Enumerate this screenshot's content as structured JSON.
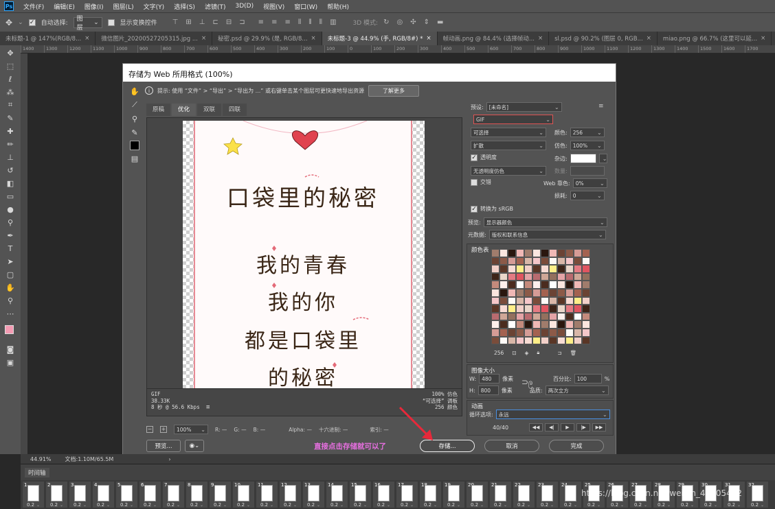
{
  "menubar": {
    "items": [
      "文件(F)",
      "编辑(E)",
      "图像(I)",
      "图层(L)",
      "文字(Y)",
      "选择(S)",
      "滤镜(T)",
      "3D(D)",
      "视图(V)",
      "窗口(W)",
      "帮助(H)"
    ]
  },
  "options": {
    "auto_select_label": "自动选择:",
    "layer_dropdown": "图层",
    "show_transform_label": "显示变换控件",
    "mode_3d_label": "3D 模式:"
  },
  "doc_tabs": [
    {
      "label": "未标题-1 @ 147%(RGB/8...",
      "active": false
    },
    {
      "label": "微信图片_20200527205315.jpg ...",
      "active": false
    },
    {
      "label": "秘密.psd @ 29.9% (是, RGB/8...",
      "active": false
    },
    {
      "label": "未标题-3 @ 44.9% (手, RGB/8#) *",
      "active": true
    },
    {
      "label": "帧动画.png @ 84.4% (选择帧动...",
      "active": false
    },
    {
      "label": "sl.psd @ 90.2% (图层 0, RGB...",
      "active": false
    },
    {
      "label": "miao.png @ 66.7% (这里可以延...",
      "active": false
    }
  ],
  "ruler": [
    "1400",
    "1300",
    "1200",
    "1100",
    "1000",
    "900",
    "800",
    "700",
    "600",
    "500",
    "400",
    "300",
    "200",
    "100",
    "0",
    "100",
    "200",
    "300",
    "400",
    "500",
    "600",
    "700",
    "800",
    "900",
    "1000",
    "1100",
    "1200",
    "1300",
    "1400",
    "1500",
    "1600",
    "1700"
  ],
  "status": {
    "zoom": "44.91%",
    "doc": "文档:1.10M/65.5M"
  },
  "timeline": {
    "title": "时间轴",
    "frame_delay": "0.2",
    "frames": [
      "1",
      "2",
      "3",
      "4",
      "5",
      "6",
      "7",
      "8",
      "9",
      "10",
      "11",
      "12",
      "13",
      "14",
      "15",
      "16",
      "17",
      "18",
      "19",
      "20",
      "21",
      "22",
      "23",
      "24",
      "25",
      "26",
      "27",
      "28",
      "29",
      "30",
      "31",
      "32"
    ],
    "watermark": "https://blog.csdn.net/weixin_45405452"
  },
  "dialog": {
    "title": "存储为 Web 所用格式 (100%)",
    "hint": "提示: 使用 “文件” > “导出” > “导出为 ...” 或右键单击某个图层可更快速地导出资源",
    "learn_more": "了解更多",
    "view_tabs": [
      "原稿",
      "优化",
      "双联",
      "四联"
    ],
    "active_tab": "优化",
    "poster": {
      "title": "口袋里的秘密",
      "lines": [
        "我的青春",
        "我的你",
        "都是口袋里",
        "的秘密"
      ]
    },
    "preview_info": {
      "format": "GIF",
      "size": "38.33K",
      "time": "8 秒 @ 56.6 Kbps",
      "dither": "100% 仿色",
      "palette": "“可选择” 调板",
      "colors": "256 颜色"
    },
    "zoom_row": {
      "zoom": "100%",
      "r": "R: —",
      "g": "G: —",
      "b": "B: —",
      "alpha": "Alpha: —",
      "hex": "十六进制: —",
      "index": "索引: —"
    },
    "buttons": {
      "preview": "预览...",
      "save": "存储...",
      "cancel": "取消",
      "done": "完成"
    },
    "annotation": "直接点击存储就可以了",
    "settings": {
      "preset_label": "预设:",
      "preset_value": "[未命名]",
      "format": "GIF",
      "reduction": "可选择",
      "dither_algo": "扩散",
      "colors_label": "颜色:",
      "colors_value": "256",
      "dither_label": "仿色:",
      "dither_value": "100%",
      "transparency_label": "透明度",
      "matte_label": "杂边:",
      "transparency_dither": "无透明度仿色",
      "amount_label": "数量:",
      "interlaced_label": "交错",
      "web_snap_label": "Web 靠色:",
      "web_snap_value": "0%",
      "lossy_label": "损耗:",
      "lossy_value": "0",
      "convert_srgb": "转换为 sRGB",
      "preview_label": "预览:",
      "preview_value": "显示器颜色",
      "metadata_label": "元数据:",
      "metadata_value": "版权和联系信息"
    },
    "color_table": {
      "title": "颜色表",
      "count": "256"
    },
    "image_size": {
      "title": "图像大小",
      "w_label": "W:",
      "w_value": "480",
      "h_label": "H:",
      "h_value": "800",
      "unit": "像素",
      "percent_label": "百分比:",
      "percent_value": "100",
      "percent_unit": "%",
      "quality_label": "品质:",
      "quality_value": "两次立方"
    },
    "animation": {
      "title": "动画",
      "loop_label": "循环选项:",
      "loop_value": "永远",
      "frame_counter": "40/40"
    }
  }
}
